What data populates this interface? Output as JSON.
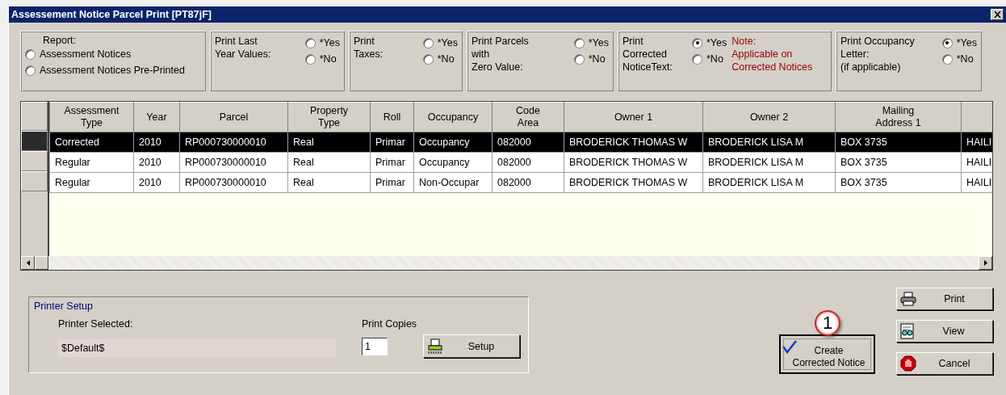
{
  "window": {
    "title": "Assessement Notice Parcel Print [PT87jF]"
  },
  "option_groups": [
    {
      "kind": "report",
      "label": "Report:",
      "options": [
        {
          "label": "Assessment Notices",
          "selected": false
        },
        {
          "label": "Assessment Notices Pre-Printed",
          "selected": false
        }
      ]
    },
    {
      "kind": "yesno",
      "label": "Print Last\nYear Values:",
      "options": [
        {
          "label": "*Yes",
          "selected": false
        },
        {
          "label": "*No",
          "selected": false
        }
      ]
    },
    {
      "kind": "yesno",
      "label": "Print\nTaxes:",
      "options": [
        {
          "label": "*Yes",
          "selected": false
        },
        {
          "label": "*No",
          "selected": false
        }
      ]
    },
    {
      "kind": "yesno",
      "label": "Print Parcels\nwith\nZero Value:",
      "options": [
        {
          "label": "*Yes",
          "selected": false
        },
        {
          "label": "*No",
          "selected": false
        }
      ]
    },
    {
      "kind": "yesno",
      "label": "Print\nCorrected\nNoticeText:",
      "options": [
        {
          "label": "*Yes",
          "selected": true
        },
        {
          "label": "*No",
          "selected": false
        }
      ],
      "note": "Note:\nApplicable on\nCorrected Notices"
    },
    {
      "kind": "yesno",
      "label": "Print Occupancy\nLetter:\n(if applicable)",
      "options": [
        {
          "label": "*Yes",
          "selected": true
        },
        {
          "label": "*No",
          "selected": false
        }
      ]
    }
  ],
  "table": {
    "columns": [
      "Assessment\nType",
      "Year",
      "Parcel",
      "Property\nType",
      "Roll",
      "Occupancy",
      "Code\nArea",
      "Owner 1",
      "Owner 2",
      "Mailing\nAddress 1"
    ],
    "rows": [
      {
        "selected": true,
        "cells": [
          "Corrected",
          "2010",
          "RP000730000010",
          "Real",
          "Primar",
          "Occupancy",
          "082000",
          "BRODERICK THOMAS W",
          "BRODERICK LISA M",
          "BOX 3735",
          "HAILI"
        ]
      },
      {
        "selected": false,
        "cells": [
          "Regular",
          "2010",
          "RP000730000010",
          "Real",
          "Primar",
          "Occupancy",
          "082000",
          "BRODERICK THOMAS W",
          "BRODERICK LISA M",
          "BOX 3735",
          "HAILI"
        ]
      },
      {
        "selected": false,
        "cells": [
          "Regular",
          "2010",
          "RP000730000010",
          "Real",
          "Primar",
          "Non-Occupar",
          "082000",
          "BRODERICK THOMAS W",
          "BRODERICK LISA M",
          "BOX 3735",
          "HAILI"
        ]
      }
    ]
  },
  "printer_setup": {
    "title": "Printer Setup",
    "printer_label": "Printer Selected:",
    "printer_value": "$Default$",
    "copies_label": "Print Copies",
    "copies_value": "1",
    "setup_button": "Setup"
  },
  "create_button": {
    "label": "Create\nCorrected Notice",
    "callout": "1"
  },
  "buttons": [
    {
      "kind": "print",
      "label": "Print"
    },
    {
      "kind": "view",
      "label": "View"
    },
    {
      "kind": "cancel",
      "label": "Cancel"
    }
  ]
}
